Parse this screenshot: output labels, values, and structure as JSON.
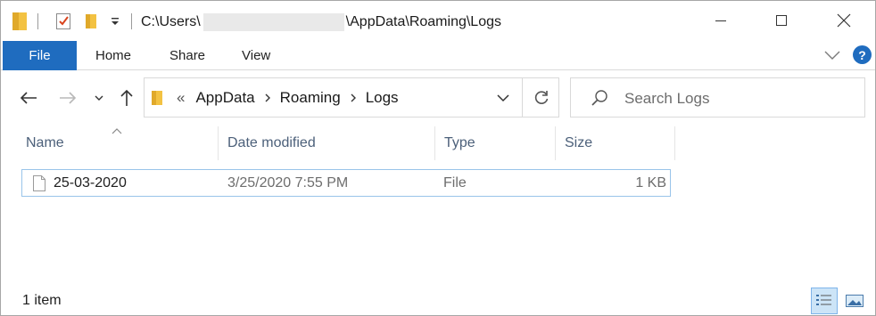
{
  "title_bar": {
    "path_prefix": "C:\\Users\\",
    "path_suffix": "\\AppData\\Roaming\\Logs",
    "quick_access_icons": [
      "folder-icon",
      "properties-icon",
      "new-folder-icon",
      "customize-dropdown-icon"
    ],
    "window_controls": [
      "minimize-icon",
      "maximize-icon",
      "close-icon"
    ]
  },
  "ribbon": {
    "tabs": [
      {
        "label": "File"
      },
      {
        "label": "Home"
      },
      {
        "label": "Share"
      },
      {
        "label": "View"
      }
    ],
    "expand_icon": "chevron-down-icon",
    "help_icon": "help-icon",
    "help_glyph": "?"
  },
  "navigation": {
    "icons": [
      "back-arrow-icon",
      "forward-arrow-icon",
      "recent-locations-icon",
      "up-arrow-icon"
    ]
  },
  "address_bar": {
    "overflow_glyph": "«",
    "breadcrumbs": [
      {
        "label": "AppData"
      },
      {
        "label": "Roaming"
      },
      {
        "label": "Logs"
      }
    ]
  },
  "search": {
    "placeholder": "Search Logs"
  },
  "file_list": {
    "columns": [
      {
        "label": "Name"
      },
      {
        "label": "Date modified"
      },
      {
        "label": "Type"
      },
      {
        "label": "Size"
      }
    ],
    "rows": [
      {
        "name": "25-03-2020",
        "date_modified": "3/25/2020 7:55 PM",
        "type": "File",
        "size": "1 KB"
      }
    ]
  },
  "status_bar": {
    "item_count": "1 item",
    "views": [
      "details-view-icon",
      "large-icons-view-icon"
    ],
    "active_view": "details-view-icon"
  },
  "colors": {
    "accent": "#1f6cbf",
    "selection_border": "#99c4ea",
    "header_text": "#4c607a",
    "folder": "#f3c242"
  }
}
